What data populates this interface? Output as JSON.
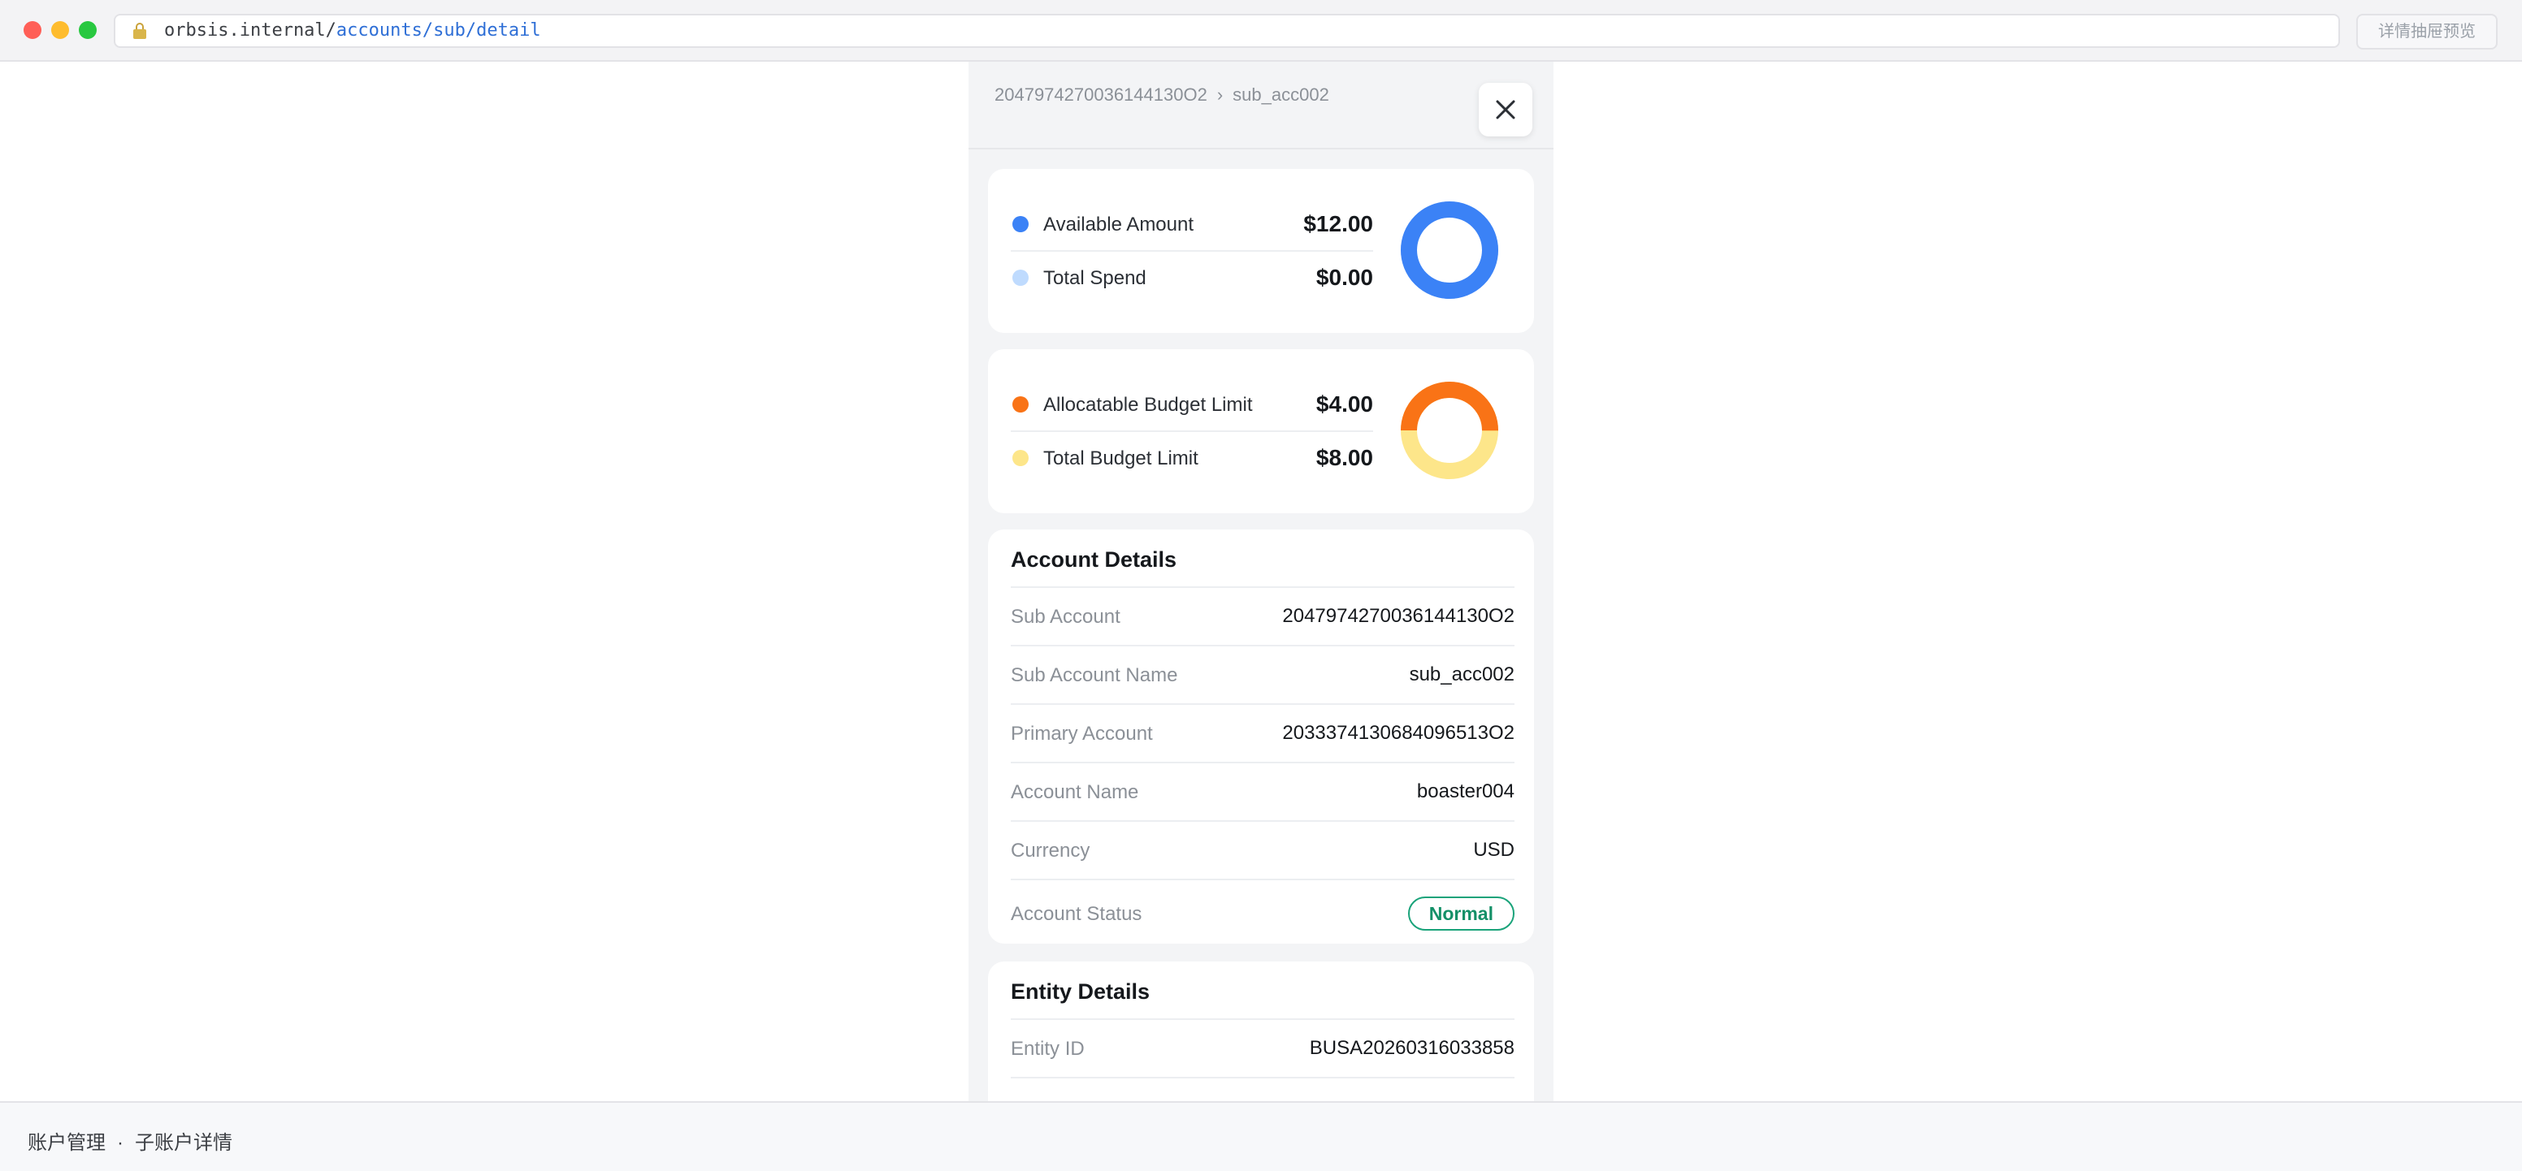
{
  "browser": {
    "url_host": "orbsis.internal/",
    "url_path": "accounts/sub/detail",
    "preview_button": "详情抽屉预览"
  },
  "drawer": {
    "breadcrumb": {
      "parent": "2047974270036144130O2",
      "separator": "›",
      "current": "sub_acc002"
    },
    "balance_card": {
      "rows": [
        {
          "label": "Available Amount",
          "value": "$12.00",
          "color": "#3b82f6"
        },
        {
          "label": "Total Spend",
          "value": "$0.00",
          "color": "#bfdbfe"
        }
      ],
      "donut_fraction_available": 1.0
    },
    "budget_card": {
      "rows": [
        {
          "label": "Allocatable Budget Limit",
          "value": "$4.00",
          "color": "#f97316"
        },
        {
          "label": "Total Budget Limit",
          "value": "$8.00",
          "color": "#fde68a"
        }
      ],
      "donut_fraction_allocatable": 0.5
    },
    "account_details": {
      "title": "Account Details",
      "rows": [
        {
          "label": "Sub Account",
          "value": "2047974270036144130O2"
        },
        {
          "label": "Sub Account Name",
          "value": "sub_acc002"
        },
        {
          "label": "Primary Account",
          "value": "2033374130684096513O2"
        },
        {
          "label": "Account Name",
          "value": "boaster004"
        },
        {
          "label": "Currency",
          "value": "USD"
        },
        {
          "label": "Account Status",
          "value": "Normal",
          "status_color": "#1aa37a"
        }
      ]
    },
    "entity_details": {
      "title": "Entity Details",
      "rows": [
        {
          "label": "Entity ID",
          "value": "BUSA20260316033858"
        }
      ]
    }
  },
  "footer": {
    "section": "账户管理",
    "separator": "·",
    "page": "子账户详情"
  }
}
